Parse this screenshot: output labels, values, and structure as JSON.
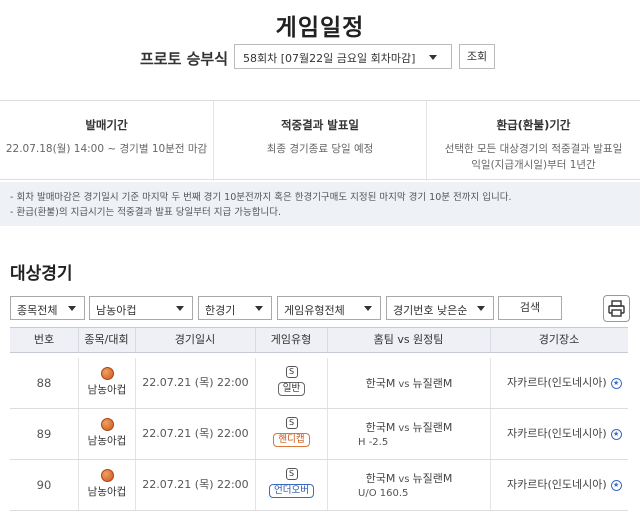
{
  "page_title": "게임일정",
  "round": {
    "label": "프로토 승부식",
    "selected": "58회차 [07월22일 금요일 회차마감]",
    "query_button": "조회"
  },
  "info": [
    {
      "head": "발매기간",
      "body": "22.07.18(월) 14:00 ~ 경기별 10분전 마감"
    },
    {
      "head": "적중결과 발표일",
      "body": "최종 경기종료 당일 예정"
    },
    {
      "head": "환급(환불)기간",
      "body": "선택한 모든 대상경기의 적중결과 발표일",
      "body2": "익일(지급개시일)부터 1년간"
    }
  ],
  "notices": [
    "- 회차 발매마감은 경기일시 기준 마지막 두 번째 경기 10분전까지 혹은 한경기구매도 지정된 마지막 경기 10분 전까지 입니다.",
    "- 환급(환불)의 지급시기는 적중결과 발표 당일부터 지급 가능합니다."
  ],
  "section_title": "대상경기",
  "filters": {
    "sport": "종목전체",
    "league": "남농아컵",
    "type": "한경기",
    "game_type": "게임유형전체",
    "sort": "경기번호 낮은순",
    "search_button": "검색",
    "print_icon": "printer-icon"
  },
  "table": {
    "headers": [
      "번호",
      "종목/대회",
      "경기일시",
      "게임유형",
      "홈팀  vs  원정팀",
      "경기장소"
    ],
    "rows": [
      {
        "no": "88",
        "sport": "남농아컵",
        "date": "22.07.21 (목) 22:00",
        "s": "S",
        "gtype": "일반",
        "home": "한국M",
        "vs": "vs",
        "away": "뉴질랜M",
        "sub": "",
        "venue": "자카르타(인도네시아)"
      },
      {
        "no": "89",
        "sport": "남농아컵",
        "date": "22.07.21 (목) 22:00",
        "s": "S",
        "gtype": "핸디캡",
        "home": "한국M",
        "vs": "vs",
        "away": "뉴질랜M",
        "sub": "H -2.5",
        "venue": "자카르타(인도네시아)"
      },
      {
        "no": "90",
        "sport": "남농아컵",
        "date": "22.07.21 (목) 22:00",
        "s": "S",
        "gtype": "언더오버",
        "home": "한국M",
        "vs": "vs",
        "away": "뉴질랜M",
        "sub": "U/O 160.5",
        "venue": "자카르타(인도네시아)"
      }
    ]
  },
  "colors": {
    "handicap": "#d9773a",
    "underover": "#3b6bc1",
    "header_bg": "#eef0f5",
    "notice_bg": "#eef1f6"
  }
}
